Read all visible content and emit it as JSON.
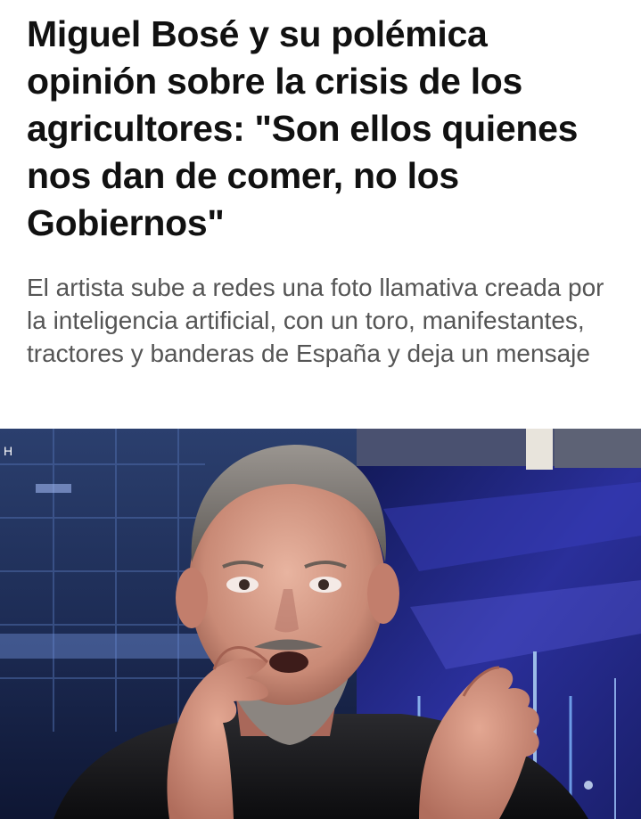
{
  "article": {
    "headline": "Miguel Bosé y su polémica opinión sobre la crisis de los agricultores: \"Son ellos quienes nos dan de comer, no los Gobiernos\"",
    "subtitle": "El artista sube a redes una foto llamativa creada por la inteligencia artificial, con un toro, manifestantes, tractores y banderas de España y deja un mensaje"
  },
  "colors": {
    "headline": "#111111",
    "subtitle": "#555555",
    "background": "#ffffff"
  }
}
